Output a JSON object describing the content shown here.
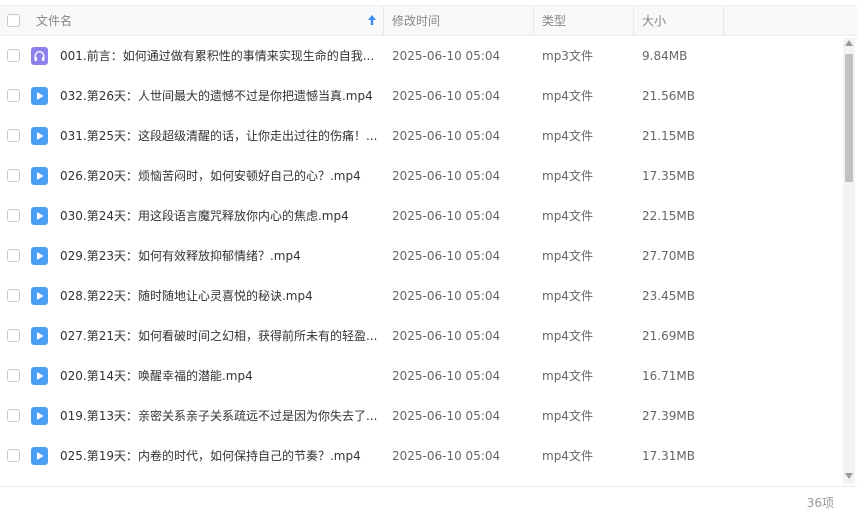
{
  "header": {
    "name_label": "文件名",
    "time_label": "修改时间",
    "type_label": "类型",
    "size_label": "大小"
  },
  "files": [
    {
      "icon": "audio-file-icon",
      "name": "001.前言：如何通过做有累积性的事情来实现生命的自我...",
      "time": "2025-06-10 05:04",
      "type": "mp3文件",
      "size": "9.84MB"
    },
    {
      "icon": "video-file-icon",
      "name": "032.第26天：人世间最大的遗憾不过是你把遗憾当真.mp4",
      "time": "2025-06-10 05:04",
      "type": "mp4文件",
      "size": "21.56MB"
    },
    {
      "icon": "video-file-icon",
      "name": "031.第25天：这段超级清醒的话，让你走出过往的伤痛！...",
      "time": "2025-06-10 05:04",
      "type": "mp4文件",
      "size": "21.15MB"
    },
    {
      "icon": "video-file-icon",
      "name": "026.第20天：烦恼苦闷时，如何安顿好自己的心？.mp4",
      "time": "2025-06-10 05:04",
      "type": "mp4文件",
      "size": "17.35MB"
    },
    {
      "icon": "video-file-icon",
      "name": "030.第24天：用这段语言魔咒释放你内心的焦虑.mp4",
      "time": "2025-06-10 05:04",
      "type": "mp4文件",
      "size": "22.15MB"
    },
    {
      "icon": "video-file-icon",
      "name": "029.第23天：如何有效释放抑郁情绪？.mp4",
      "time": "2025-06-10 05:04",
      "type": "mp4文件",
      "size": "27.70MB"
    },
    {
      "icon": "video-file-icon",
      "name": "028.第22天：随时随地让心灵喜悦的秘诀.mp4",
      "time": "2025-06-10 05:04",
      "type": "mp4文件",
      "size": "23.45MB"
    },
    {
      "icon": "video-file-icon",
      "name": "027.第21天：如何看破时间之幻相，获得前所未有的轻盈...",
      "time": "2025-06-10 05:04",
      "type": "mp4文件",
      "size": "21.69MB"
    },
    {
      "icon": "video-file-icon",
      "name": "020.第14天：唤醒幸福的潜能.mp4",
      "time": "2025-06-10 05:04",
      "type": "mp4文件",
      "size": "16.71MB"
    },
    {
      "icon": "video-file-icon",
      "name": "019.第13天：亲密关系亲子关系疏远不过是因为你失去了...",
      "time": "2025-06-10 05:04",
      "type": "mp4文件",
      "size": "27.39MB"
    },
    {
      "icon": "video-file-icon",
      "name": "025.第19天：内卷的时代，如何保持自己的节奏？.mp4",
      "time": "2025-06-10 05:04",
      "type": "mp4文件",
      "size": "17.31MB"
    }
  ],
  "footer": {
    "count": "36项"
  },
  "colors": {
    "audio_icon": "#8b82f0",
    "video_icon": "#4a9ff5",
    "sort_arrow": "#3b8cf0"
  }
}
